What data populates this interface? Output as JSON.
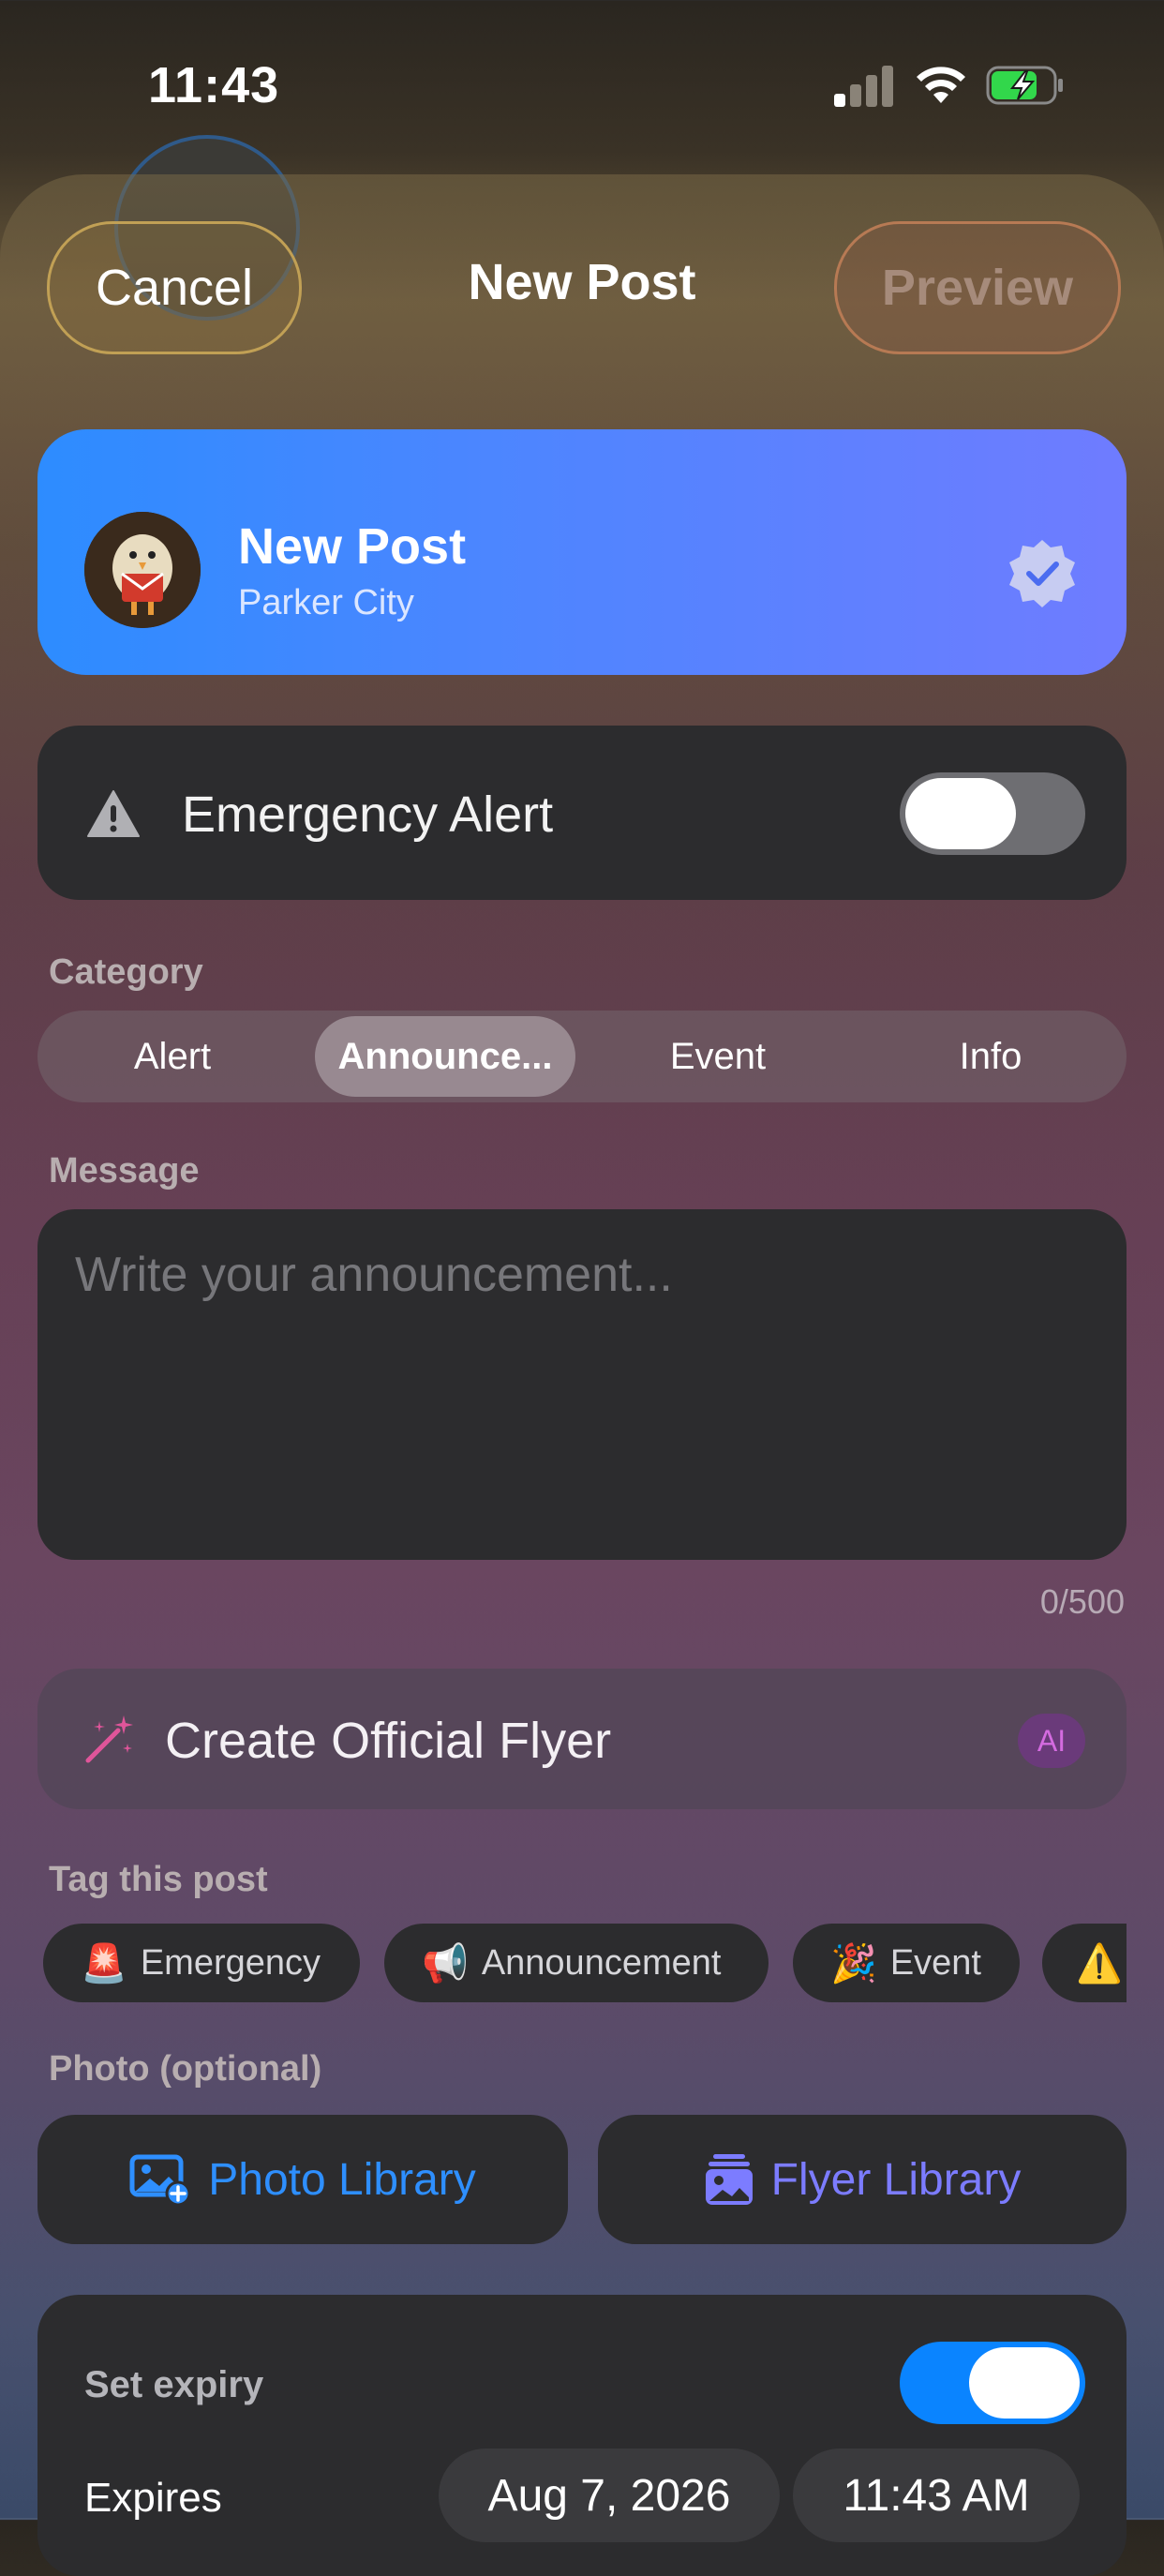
{
  "status_bar": {
    "time": "11:43"
  },
  "nav": {
    "cancel_label": "Cancel",
    "title": "New Post",
    "preview_label": "Preview"
  },
  "header": {
    "title": "New Post",
    "subtitle": "Parker City"
  },
  "emergency": {
    "label": "Emergency Alert",
    "enabled": false
  },
  "category": {
    "label": "Category",
    "options": [
      "Alert",
      "Announce...",
      "Event",
      "Info"
    ],
    "selected": "Announce..."
  },
  "message": {
    "label": "Message",
    "placeholder": "Write your announcement...",
    "counter": "0/500"
  },
  "flyer": {
    "label": "Create Official Flyer",
    "badge": "AI"
  },
  "tags": {
    "label": "Tag this post",
    "items": [
      {
        "emoji": "🚨",
        "label": "Emergency"
      },
      {
        "emoji": "📢",
        "label": "Announcement"
      },
      {
        "emoji": "🎉",
        "label": "Event"
      },
      {
        "emoji": "⚠️",
        "label": ""
      }
    ]
  },
  "photo": {
    "label": "Photo (optional)",
    "photo_library": "Photo Library",
    "flyer_library": "Flyer Library"
  },
  "expiry": {
    "label": "Set expiry",
    "enabled": true,
    "expires_label": "Expires",
    "date": "Aug 7, 2026",
    "time": "11:43 AM"
  },
  "colors": {
    "accent_blue": "#0a84ff",
    "flyer_purple": "#7c7cff",
    "card_bg": "#2c2c2e"
  },
  "icons": [
    "signal-icon",
    "wifi-icon",
    "battery-charging-icon",
    "verified-badge-icon",
    "warning-triangle-icon",
    "magic-wand-icon",
    "photo-add-icon",
    "stack-photo-icon"
  ]
}
